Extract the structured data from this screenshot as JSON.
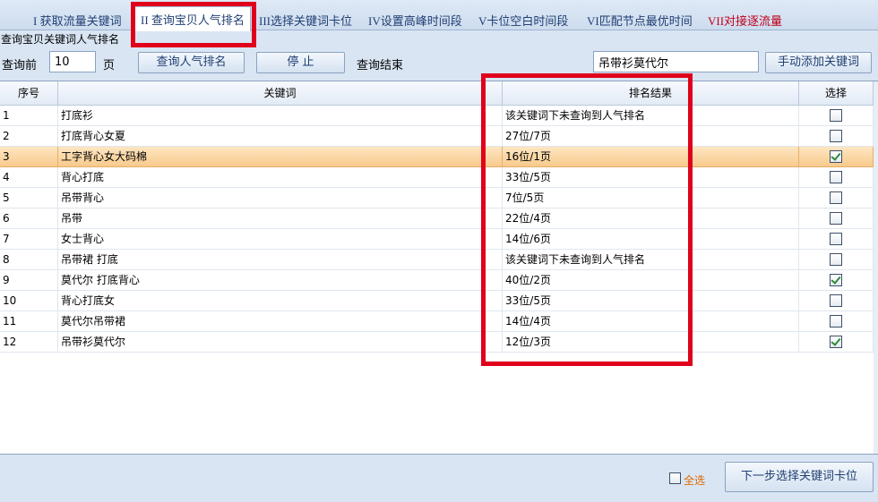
{
  "tabs": [
    {
      "label": "I 获取流量关键词"
    },
    {
      "label": "II 查询宝贝人气排名"
    },
    {
      "label": "III选择关键词卡位"
    },
    {
      "label": "IV设置高峰时间段"
    },
    {
      "label": "V卡位空白时间段"
    },
    {
      "label": "VI匹配节点最优时间"
    },
    {
      "label": "VII对接逐流量"
    }
  ],
  "section_title": "查询宝贝关键词人气排名",
  "toolbar": {
    "query_before_label": "查询前",
    "pages_value": "10",
    "page_unit": "页",
    "query_rank_button": "查询人气排名",
    "stop_button": "停 止",
    "status": "查询结束",
    "keyword_value": "吊带衫莫代尔",
    "add_keyword_button": "手动添加关键词"
  },
  "table": {
    "columns": [
      "序号",
      "关键词",
      "排名结果",
      "选择"
    ],
    "rows": [
      {
        "no": "1",
        "keyword": "打底衫",
        "result": "该关键词下未查询到人气排名",
        "checked": false
      },
      {
        "no": "2",
        "keyword": "打底背心女夏",
        "result": "27位/7页",
        "checked": false
      },
      {
        "no": "3",
        "keyword": "工字背心女大码棉",
        "result": "16位/1页",
        "checked": true,
        "selected": true
      },
      {
        "no": "4",
        "keyword": "背心打底",
        "result": "33位/5页",
        "checked": false
      },
      {
        "no": "5",
        "keyword": "吊带背心",
        "result": "7位/5页",
        "checked": false
      },
      {
        "no": "6",
        "keyword": "吊带",
        "result": "22位/4页",
        "checked": false
      },
      {
        "no": "7",
        "keyword": "女士背心",
        "result": "14位/6页",
        "checked": false
      },
      {
        "no": "8",
        "keyword": "吊带裙 打底",
        "result": "该关键词下未查询到人气排名",
        "checked": false
      },
      {
        "no": "9",
        "keyword": "莫代尔 打底背心",
        "result": "40位/2页",
        "checked": true
      },
      {
        "no": "10",
        "keyword": "背心打底女",
        "result": "33位/5页",
        "checked": false
      },
      {
        "no": "11",
        "keyword": "莫代尔吊带裙",
        "result": "14位/4页",
        "checked": false
      },
      {
        "no": "12",
        "keyword": "吊带衫莫代尔",
        "result": "12位/3页",
        "checked": true
      }
    ]
  },
  "footer": {
    "select_all_label": "全选",
    "next_button": "下一步选择关键词卡位"
  },
  "colors": {
    "annotation_red": "#e0001b",
    "selected_row": "#f8c98a",
    "select_all_text": "#e06a00"
  }
}
